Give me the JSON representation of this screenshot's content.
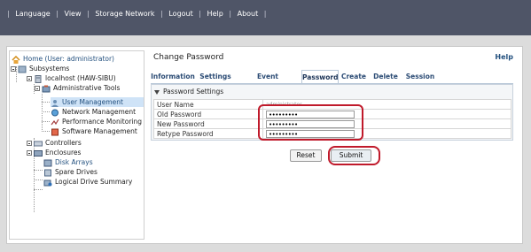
{
  "topmenu": {
    "items": [
      "Language",
      "View",
      "Storage Network",
      "Logout",
      "Help",
      "About"
    ]
  },
  "tree": {
    "home": "Home (User: administrator)",
    "subsystems": "Subsystems",
    "host": "localhost (HAW-SIBU)",
    "admin_tools": "Administrative Tools",
    "user_mgmt": "User Management",
    "net_mgmt": "Network Management",
    "perf_mon": "Performance Monitoring",
    "sw_mgmt": "Software Management",
    "controllers": "Controllers",
    "enclosures": "Enclosures",
    "disk_arrays": "Disk Arrays",
    "spare_drives": "Spare Drives",
    "logical_summary": "Logical Drive Summary"
  },
  "main": {
    "title": "Change Password",
    "help": "Help",
    "tabs": [
      "Information",
      "Settings",
      "Event Subscription",
      "Password",
      "Create",
      "Delete",
      "Session"
    ],
    "active_tab": "Password",
    "section_title": "Password Settings",
    "fields": [
      {
        "label": "User Name",
        "value": "administrator"
      },
      {
        "label": "Old Password",
        "value": "•••••••••"
      },
      {
        "label": "New Password",
        "value": "•••••••••"
      },
      {
        "label": "Retype Password",
        "value": "•••••••••"
      }
    ],
    "reset_label": "Reset",
    "submit_label": "Submit"
  },
  "colors": {
    "topbar": "#4f5567",
    "highlight": "#c01a2b",
    "tab_text": "#2c4c75",
    "selected_row": "#cfe3f7"
  }
}
